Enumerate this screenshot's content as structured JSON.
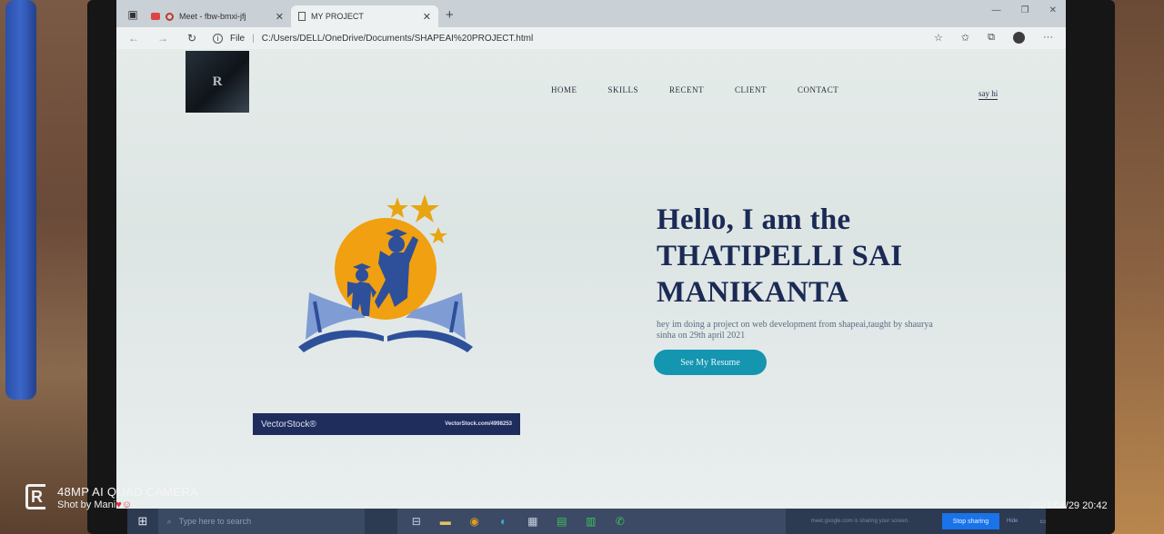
{
  "browser": {
    "tabs": [
      {
        "title": "Meet - fbw-bmxi-jfj",
        "active": false
      },
      {
        "title": "MY PROJECT",
        "active": true
      }
    ],
    "new_tab": "+",
    "address": {
      "scheme_label": "File",
      "url": "C:/Users/DELL/OneDrive/Documents/SHAPEAI%20PROJECT.html"
    }
  },
  "site": {
    "logo_text": "R",
    "nav": [
      "HOME",
      "SKILLS",
      "RECENT",
      "CLIENT",
      "CONTACT"
    ],
    "cta_link": "say hi",
    "hero": {
      "heading_line1": "Hello, I am the",
      "heading_line2": "THATIPELLI SAI",
      "heading_line3": "MANIKANTA",
      "description": "hey im doing a project on web development from shapeai,taught by shaurya sinha on 29th april 2021",
      "button_label": "See My Resume"
    },
    "watermark": {
      "brand": "VectorStock®",
      "ref": "VectorStock.com/4998253"
    }
  },
  "taskbar": {
    "search_placeholder": "Type here to search",
    "share_message": "meet.google.com is sharing your screen.",
    "stop_sharing": "Stop sharing",
    "hide": "Hide"
  },
  "photo_overlay": {
    "camera": "48MP AI QUAD CAMERA",
    "shot_by": "Shot by Mani",
    "datetime": "2021/04/29 20:42"
  },
  "colors": {
    "heading": "#1b2a55",
    "button": "#1495b0",
    "illustration_orange": "#f0a010",
    "illustration_blue": "#2e4f9a",
    "taskbar": "#2c3a52"
  }
}
